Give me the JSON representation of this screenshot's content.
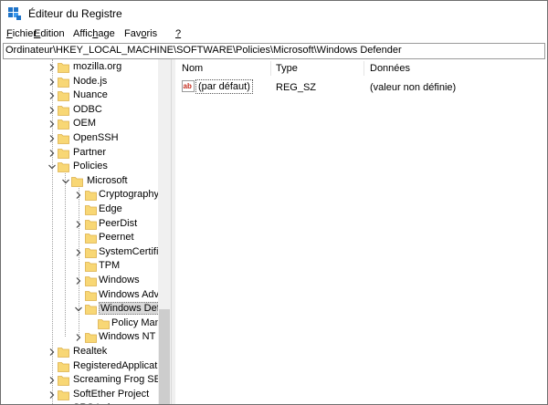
{
  "window": {
    "title": "Éditeur du Registre"
  },
  "menu": [
    {
      "label": "Fichier",
      "key": "F",
      "rest": "ichier"
    },
    {
      "label": "Edition",
      "key": "E",
      "rest": "dition"
    },
    {
      "label": "Affichage",
      "pre": "Affic",
      "key": "h",
      "rest": "age"
    },
    {
      "label": "Favoris",
      "pre": "Fav",
      "key": "o",
      "rest": "ris"
    },
    {
      "label": "?",
      "key": "?",
      "rest": ""
    }
  ],
  "address": "Ordinateur\\HKEY_LOCAL_MACHINE\\SOFTWARE\\Policies\\Microsoft\\Windows Defender",
  "tree": [
    {
      "label": "mozilla.org",
      "level": 0,
      "expander": "collapsed"
    },
    {
      "label": "Node.js",
      "level": 0,
      "expander": "collapsed"
    },
    {
      "label": "Nuance",
      "level": 0,
      "expander": "collapsed"
    },
    {
      "label": "ODBC",
      "level": 0,
      "expander": "collapsed"
    },
    {
      "label": "OEM",
      "level": 0,
      "expander": "collapsed"
    },
    {
      "label": "OpenSSH",
      "level": 0,
      "expander": "collapsed"
    },
    {
      "label": "Partner",
      "level": 0,
      "expander": "collapsed"
    },
    {
      "label": "Policies",
      "level": 0,
      "expander": "expanded"
    },
    {
      "label": "Microsoft",
      "level": 1,
      "expander": "expanded"
    },
    {
      "label": "Cryptography",
      "level": 2,
      "expander": "collapsed"
    },
    {
      "label": "Edge",
      "level": 2,
      "expander": "none"
    },
    {
      "label": "PeerDist",
      "level": 2,
      "expander": "collapsed"
    },
    {
      "label": "Peernet",
      "level": 2,
      "expander": "none"
    },
    {
      "label": "SystemCertific",
      "level": 2,
      "expander": "collapsed"
    },
    {
      "label": "TPM",
      "level": 2,
      "expander": "none"
    },
    {
      "label": "Windows",
      "level": 2,
      "expander": "collapsed"
    },
    {
      "label": "Windows Adva",
      "level": 2,
      "expander": "none"
    },
    {
      "label": "Windows Defe",
      "level": 2,
      "expander": "expanded",
      "selected": true
    },
    {
      "label": "Policy Man",
      "level": 3,
      "expander": "none"
    },
    {
      "label": "Windows NT",
      "level": 2,
      "expander": "collapsed"
    },
    {
      "label": "Realtek",
      "level": 0,
      "expander": "collapsed"
    },
    {
      "label": "RegisteredApplicatio",
      "level": 0,
      "expander": "none"
    },
    {
      "label": "Screaming Frog SEO",
      "level": 0,
      "expander": "collapsed"
    },
    {
      "label": "SoftEther Project",
      "level": 0,
      "expander": "collapsed"
    },
    {
      "label": "SRS Labs",
      "level": 0,
      "expander": "collapsed"
    }
  ],
  "list": {
    "columns": [
      "Nom",
      "Type",
      "Données"
    ],
    "rows": [
      {
        "name": "(par défaut)",
        "type": "REG_SZ",
        "data": "(valeur non définie)"
      }
    ]
  },
  "colors": {
    "folder": "#f8d775",
    "folder_edge": "#dcb04a",
    "selection": "#d9d9d9",
    "ab_red": "#c42b1c"
  },
  "icons": {
    "app": "registry-editor-icon",
    "folder": "folder-icon",
    "value": "string-value-icon"
  }
}
